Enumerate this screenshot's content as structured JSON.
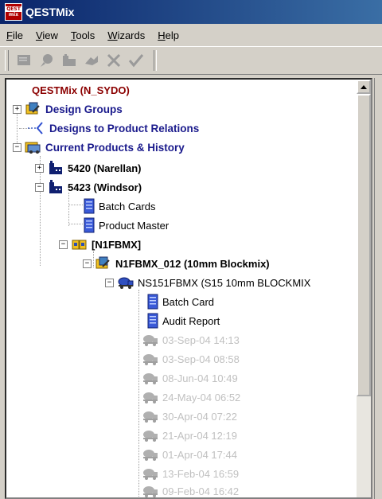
{
  "window": {
    "title": "QESTMix",
    "icon_top": "QEST",
    "icon_bottom": "mix"
  },
  "menu": [
    {
      "first": "F",
      "rest": "ile"
    },
    {
      "first": "V",
      "rest": "iew"
    },
    {
      "first": "T",
      "rest": "ools"
    },
    {
      "first": "W",
      "rest": "izards"
    },
    {
      "first": "H",
      "rest": "elp"
    }
  ],
  "toolbar": {
    "icons": [
      "edit-card-icon",
      "pin-icon",
      "add-product-icon",
      "move-icon",
      "delete-icon",
      "check-icon"
    ]
  },
  "tree": {
    "root": "QESTMix (N_SYDO)",
    "design_groups": "Design Groups",
    "designs_to_product": "Designs to Product Relations",
    "current_products": "Current Products & History",
    "plant_5420": "5420 (Narellan)",
    "plant_5423": "5423 (Windsor)",
    "batch_cards": "Batch Cards",
    "product_master": "Product Master",
    "n1fbmx": "[N1FBMX]",
    "n1fbmx_012": "N1FBMX_012 (10mm Blockmix)",
    "ns151": "NS151FBMX (S15 10mm BLOCKMIX",
    "batch_card": "Batch Card",
    "audit_report": "Audit Report",
    "history": [
      "03-Sep-04 14:13",
      "03-Sep-04 08:58",
      "08-Jun-04 10:49",
      "24-May-04 06:52",
      "30-Apr-04 07:22",
      "21-Apr-04 12:19",
      "01-Apr-04 17:44",
      "13-Feb-04 16:59",
      "09-Feb-04 16:42"
    ]
  },
  "expanders": {
    "plus": "+",
    "minus": "−"
  },
  "colors": {
    "title_start": "#0a246a",
    "title_end": "#3a6ea5",
    "root_text": "#8b0000",
    "link_text": "#1a1a8c",
    "history_text": "#c0c0c0"
  }
}
